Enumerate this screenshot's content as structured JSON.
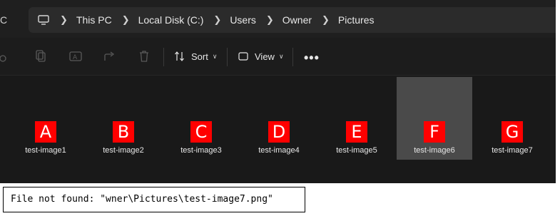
{
  "address_bar": {
    "breadcrumbs": [
      "This PC",
      "Local Disk (C:)",
      "Users",
      "Owner",
      "Pictures"
    ]
  },
  "toolbar": {
    "sort_label": "Sort",
    "view_label": "View",
    "more_label": "•••"
  },
  "files": [
    {
      "name": "test-image1",
      "letter": "A",
      "selected": false
    },
    {
      "name": "test-image2",
      "letter": "B",
      "selected": false
    },
    {
      "name": "test-image3",
      "letter": "C",
      "selected": false
    },
    {
      "name": "test-image4",
      "letter": "D",
      "selected": false
    },
    {
      "name": "test-image5",
      "letter": "E",
      "selected": false
    },
    {
      "name": "test-image6",
      "letter": "F",
      "selected": true
    },
    {
      "name": "test-image7",
      "letter": "G",
      "selected": false
    }
  ],
  "error_message": "File not found: \"wner\\Pictures\\test-image7.png\"",
  "colors": {
    "background": "#191919",
    "thumbnail": "#ff0000",
    "selection": "#4a4a4a"
  }
}
